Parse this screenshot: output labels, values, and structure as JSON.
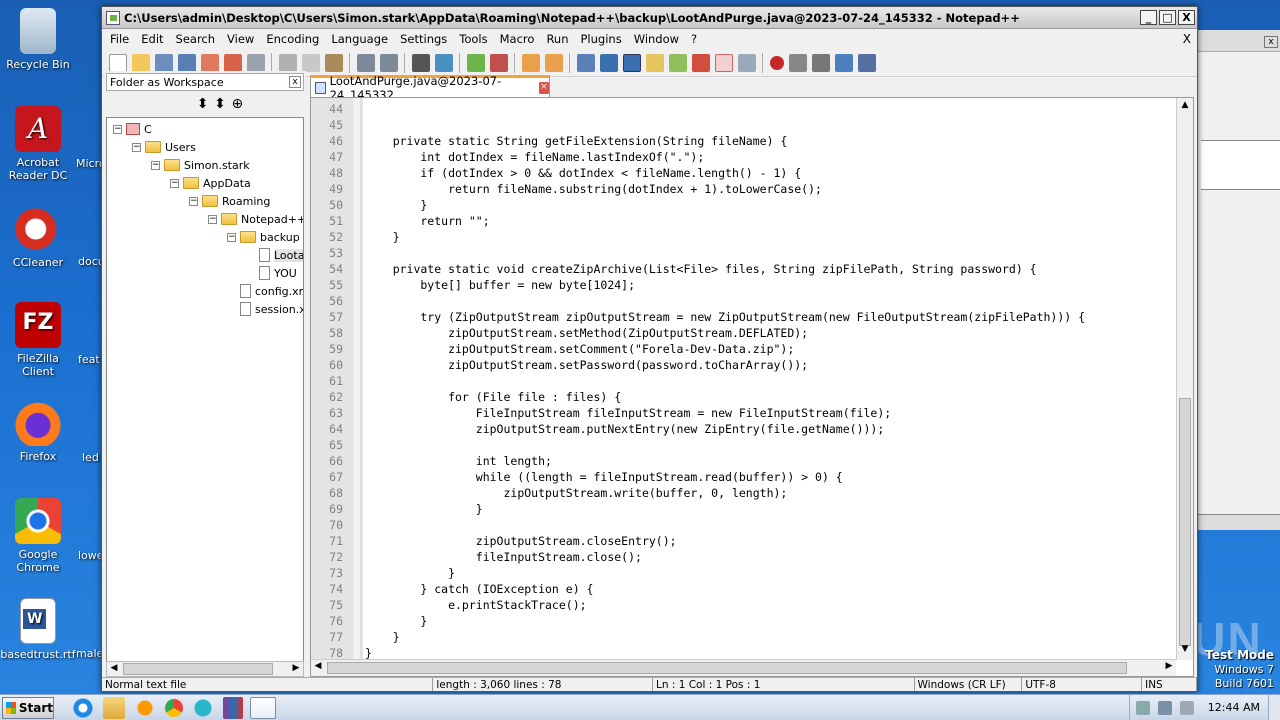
{
  "desktop": {
    "icons": [
      {
        "label": "Recycle Bin"
      },
      {
        "label": "Acrobat Reader DC"
      },
      {
        "label": "CCleaner"
      },
      {
        "label": "FileZilla Client"
      },
      {
        "label": "Firefox"
      },
      {
        "label": "Google Chrome"
      },
      {
        "label": "basedtrust.rtf"
      }
    ],
    "partial_labels": [
      "Micro",
      "docu",
      "feat",
      "led",
      "lowe",
      "male"
    ],
    "watermark": "ANY RUN",
    "test_mode": {
      "line1": "Test Mode",
      "line2": "Windows 7",
      "line3": "Build 7601"
    }
  },
  "window": {
    "title": "C:\\Users\\admin\\Desktop\\C\\Users\\Simon.stark\\AppData\\Roaming\\Notepad++\\backup\\LootAndPurge.java@2023-07-24_145332 - Notepad++",
    "caption_buttons": {
      "minimize": "_",
      "maximize": "□",
      "close": "X"
    },
    "menu": [
      "File",
      "Edit",
      "Search",
      "View",
      "Encoding",
      "Language",
      "Settings",
      "Tools",
      "Macro",
      "Run",
      "Plugins",
      "Window",
      "?"
    ],
    "menu_close": "X"
  },
  "workspace": {
    "title": "Folder as Workspace",
    "close": "x",
    "tools": [
      "⬍",
      "⬍",
      "⊕"
    ],
    "tree": [
      {
        "label": "C",
        "type": "drive"
      },
      {
        "label": "Users",
        "type": "folder"
      },
      {
        "label": "Simon.stark",
        "type": "folder"
      },
      {
        "label": "AppData",
        "type": "folder"
      },
      {
        "label": "Roaming",
        "type": "folder"
      },
      {
        "label": "Notepad++",
        "type": "folder"
      },
      {
        "label": "backup",
        "type": "folder"
      },
      {
        "label": "Loota",
        "type": "file"
      },
      {
        "label": "YOU",
        "type": "file"
      },
      {
        "label": "config.xn",
        "type": "file"
      },
      {
        "label": "session.x",
        "type": "file"
      }
    ]
  },
  "editor": {
    "tab_label": "LootAndPurge.java@2023-07-24_145332",
    "lines": [
      {
        "n": "44",
        "code": ""
      },
      {
        "n": "45",
        "code": ""
      },
      {
        "n": "46",
        "code": "    private static String getFileExtension(String fileName) {"
      },
      {
        "n": "47",
        "code": "        int dotIndex = fileName.lastIndexOf(\".\");"
      },
      {
        "n": "48",
        "code": "        if (dotIndex > 0 && dotIndex < fileName.length() - 1) {"
      },
      {
        "n": "49",
        "code": "            return fileName.substring(dotIndex + 1).toLowerCase();"
      },
      {
        "n": "50",
        "code": "        }"
      },
      {
        "n": "51",
        "code": "        return \"\";"
      },
      {
        "n": "52",
        "code": "    }"
      },
      {
        "n": "53",
        "code": ""
      },
      {
        "n": "54",
        "code": "    private static void createZipArchive(List<File> files, String zipFilePath, String password) {"
      },
      {
        "n": "55",
        "code": "        byte[] buffer = new byte[1024];"
      },
      {
        "n": "56",
        "code": ""
      },
      {
        "n": "57",
        "code": "        try (ZipOutputStream zipOutputStream = new ZipOutputStream(new FileOutputStream(zipFilePath))) {"
      },
      {
        "n": "58",
        "code": "            zipOutputStream.setMethod(ZipOutputStream.DEFLATED);"
      },
      {
        "n": "59",
        "code": "            zipOutputStream.setComment(\"Forela-Dev-Data.zip\");"
      },
      {
        "n": "60",
        "code": "            zipOutputStream.setPassword(password.toCharArray());"
      },
      {
        "n": "61",
        "code": ""
      },
      {
        "n": "62",
        "code": "            for (File file : files) {"
      },
      {
        "n": "63",
        "code": "                FileInputStream fileInputStream = new FileInputStream(file);"
      },
      {
        "n": "64",
        "code": "                zipOutputStream.putNextEntry(new ZipEntry(file.getName()));"
      },
      {
        "n": "65",
        "code": ""
      },
      {
        "n": "66",
        "code": "                int length;"
      },
      {
        "n": "67",
        "code": "                while ((length = fileInputStream.read(buffer)) > 0) {"
      },
      {
        "n": "68",
        "code": "                    zipOutputStream.write(buffer, 0, length);"
      },
      {
        "n": "69",
        "code": "                }"
      },
      {
        "n": "70",
        "code": ""
      },
      {
        "n": "71",
        "code": "                zipOutputStream.closeEntry();"
      },
      {
        "n": "72",
        "code": "                fileInputStream.close();"
      },
      {
        "n": "73",
        "code": "            }"
      },
      {
        "n": "74",
        "code": "        } catch (IOException e) {"
      },
      {
        "n": "75",
        "code": "            e.printStackTrace();"
      },
      {
        "n": "76",
        "code": "        }"
      },
      {
        "n": "77",
        "code": "    }"
      },
      {
        "n": "78",
        "code": "}"
      }
    ]
  },
  "status": {
    "type": "Normal text file",
    "length": "length : 3,060    lines : 78",
    "pos": "Ln : 1    Col : 1    Pos : 1",
    "eol": "Windows (CR LF)",
    "encoding": "UTF-8",
    "mode": "INS"
  },
  "taskbar": {
    "start": "Start",
    "clock": "12:44 AM"
  },
  "colors": {
    "tab_accent": "#f2a33a",
    "desktop": "#1b6fd0"
  }
}
